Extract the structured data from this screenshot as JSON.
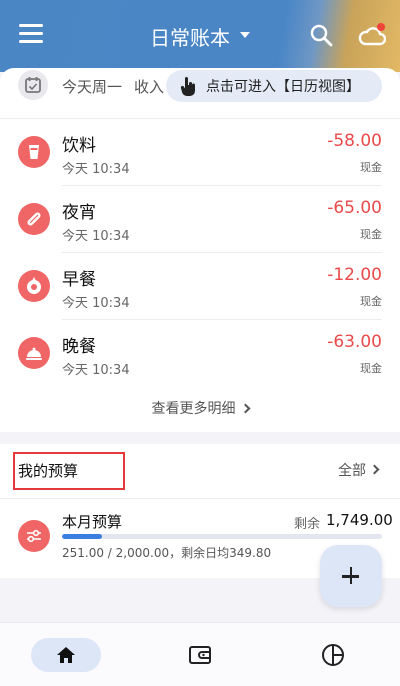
{
  "header": {
    "title": "日常账本",
    "menu_icon": "menu-icon",
    "search_icon": "search-icon",
    "cloud_icon": "cloud-sync-icon"
  },
  "summary": {
    "date": "今天周一",
    "income_label": "收入",
    "tooltip": "点击可进入【日历视图】"
  },
  "transactions": [
    {
      "name": "饮料",
      "time": "今天 10:34",
      "amount": "-58.00",
      "account": "现金",
      "icon": "drink-icon"
    },
    {
      "name": "夜宵",
      "time": "今天 10:34",
      "amount": "-65.00",
      "account": "现金",
      "icon": "snack-icon"
    },
    {
      "name": "早餐",
      "time": "今天 10:34",
      "amount": "-12.00",
      "account": "现金",
      "icon": "breakfast-icon"
    },
    {
      "name": "晚餐",
      "time": "今天 10:34",
      "amount": "-63.00",
      "account": "现金",
      "icon": "dinner-icon"
    }
  ],
  "more_label": "查看更多明细",
  "budget": {
    "title": "我的预算",
    "all_label": "全部",
    "item_name": "本月预算",
    "remaining_label": "剩余",
    "remaining_value": "1,749.00",
    "detail": "251.00 / 2,000.00，剩余日均349.80",
    "progress": 0.1255
  },
  "nav": {
    "home": "home-icon",
    "wallet": "wallet-icon",
    "chart": "pie-chart-icon"
  },
  "colors": {
    "accent": "#4a86c6",
    "expense": "#ea4a4a",
    "category": "#f06666",
    "progress": "#3a7fe0"
  }
}
